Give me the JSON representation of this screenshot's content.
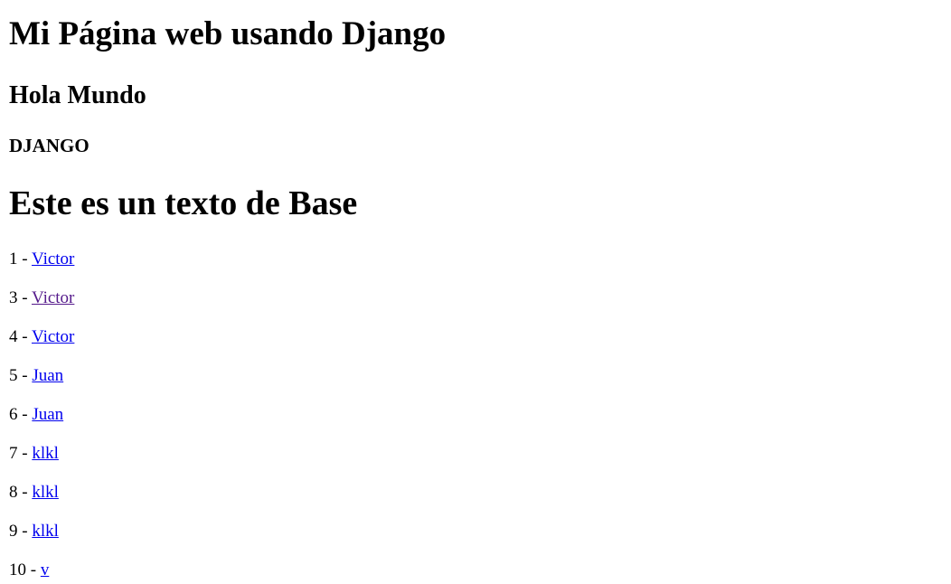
{
  "page": {
    "title": "Mi Página web usando Django",
    "subtitle": "Hola Mundo",
    "section": "DJANGO",
    "base_text": "Este es un texto de Base"
  },
  "items": [
    {
      "prefix": "1 - ",
      "name": "Victor",
      "visited": false
    },
    {
      "prefix": "3 - ",
      "name": "Victor",
      "visited": true
    },
    {
      "prefix": "4 - ",
      "name": "Victor",
      "visited": false
    },
    {
      "prefix": "5 - ",
      "name": "Juan",
      "visited": false
    },
    {
      "prefix": "6 - ",
      "name": "Juan",
      "visited": false
    },
    {
      "prefix": "7 - ",
      "name": "klkl",
      "visited": false
    },
    {
      "prefix": "8 - ",
      "name": "klkl",
      "visited": false
    },
    {
      "prefix": "9 - ",
      "name": "klkl",
      "visited": false
    },
    {
      "prefix": "10 - ",
      "name": "v",
      "visited": false
    }
  ],
  "colors": {
    "link": "#0000ee",
    "visited_link": "#551a8b",
    "text": "#000000",
    "background": "#ffffff"
  }
}
